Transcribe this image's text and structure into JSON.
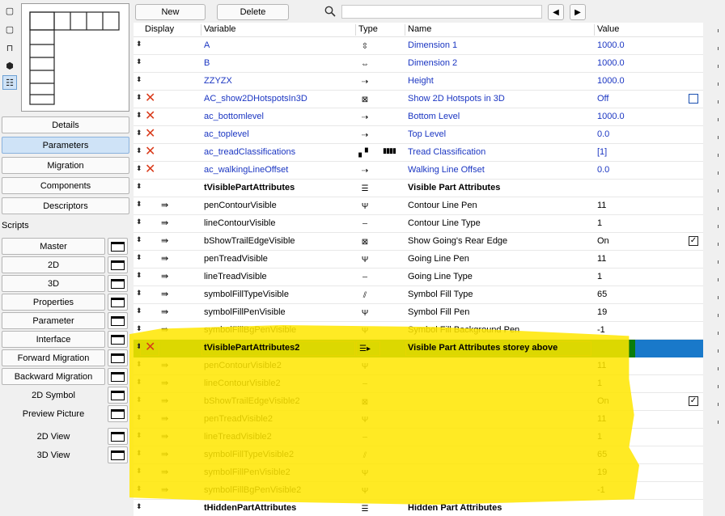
{
  "toolbar": {
    "new_label": "New",
    "delete_label": "Delete",
    "search_placeholder": "",
    "prev_label": "◀",
    "next_label": "▶"
  },
  "left_panel": {
    "sections": [
      "Details",
      "Parameters",
      "Migration",
      "Components",
      "Descriptors"
    ],
    "scripts_label": "Scripts",
    "scripts": [
      "Master",
      "2D",
      "3D",
      "Properties",
      "Parameter",
      "Interface",
      "Forward Migration",
      "Backward Migration"
    ],
    "plain_items": [
      "2D Symbol",
      "Preview Picture"
    ],
    "views": [
      "2D View",
      "3D View"
    ]
  },
  "table": {
    "headers": {
      "display": "Display",
      "variable": "Variable",
      "type": "Type",
      "name": "Name",
      "value": "Value"
    },
    "rows": [
      {
        "var": "A",
        "type_icon": "⇳",
        "name": "Dimension 1",
        "value": "1000.0",
        "style": "blue",
        "x": false,
        "disp": ""
      },
      {
        "var": "B",
        "type_icon": "⇔",
        "name": "Dimension 2",
        "value": "1000.0",
        "style": "blue",
        "x": false,
        "disp": ""
      },
      {
        "var": "ZZYZX",
        "type_icon": "⇢",
        "name": "Height",
        "value": "1000.0",
        "style": "blue",
        "x": false,
        "disp": ""
      },
      {
        "var": "AC_show2DHotspotsIn3D",
        "type_icon": "⊠",
        "name": "Show 2D Hotspots in 3D",
        "value": "Off",
        "style": "blue",
        "x": true,
        "disp": "",
        "check": "empty"
      },
      {
        "var": "ac_bottomlevel",
        "type_icon": "⇢",
        "name": "Bottom Level",
        "value": "1000.0",
        "style": "blue",
        "x": true,
        "disp": ""
      },
      {
        "var": "ac_toplevel",
        "type_icon": "⇢",
        "name": "Top Level",
        "value": "0.0",
        "style": "blue",
        "x": true,
        "disp": ""
      },
      {
        "var": "ac_treadClassifications",
        "type_icon": "▖▘",
        "type2": "▮▮▮▮",
        "name": "Tread Classification",
        "value": "[1]",
        "style": "blue",
        "x": true,
        "disp": ""
      },
      {
        "var": "ac_walkingLineOffset",
        "type_icon": "⇢",
        "name": "Walking Line Offset",
        "value": "0.0",
        "style": "blue",
        "x": true,
        "disp": ""
      },
      {
        "var": "tVisiblePartAttributes",
        "type_icon": "☰",
        "name": "Visible Part Attributes",
        "value": "",
        "style": "bold",
        "x": false,
        "disp": ""
      },
      {
        "var": "penContourVisible",
        "type_icon": "Ψ",
        "name": "Contour Line Pen",
        "value": "11",
        "style": "normal",
        "x": false,
        "disp": "⇛"
      },
      {
        "var": "lineContourVisible",
        "type_icon": "┄",
        "name": "Contour Line Type",
        "value": "1",
        "style": "normal",
        "x": false,
        "disp": "⇛"
      },
      {
        "var": "bShowTrailEdgeVisible",
        "type_icon": "⊠",
        "name": "Show Going's Rear Edge",
        "value": "On",
        "style": "normal",
        "x": false,
        "disp": "⇛",
        "check": "checked"
      },
      {
        "var": "penTreadVisible",
        "type_icon": "Ψ",
        "name": "Going Line Pen",
        "value": "11",
        "style": "normal",
        "x": false,
        "disp": "⇛"
      },
      {
        "var": "lineTreadVisible",
        "type_icon": "┄",
        "name": "Going Line Type",
        "value": "1",
        "style": "normal",
        "x": false,
        "disp": "⇛"
      },
      {
        "var": "symbolFillTypeVisible",
        "type_icon": "⫽",
        "name": "Symbol Fill Type",
        "value": "65",
        "style": "normal",
        "x": false,
        "disp": "⇛"
      },
      {
        "var": "symbolFillPenVisible",
        "type_icon": "Ψ",
        "name": "Symbol Fill Pen",
        "value": "19",
        "style": "normal",
        "x": false,
        "disp": "⇛"
      },
      {
        "var": "symbolFillBgPenVisible",
        "type_icon": "Ψ",
        "name": "Symbol Fill Background Pen",
        "value": "-1",
        "style": "normal",
        "x": false,
        "disp": "⇛"
      },
      {
        "var": "tVisiblePartAttributes2",
        "type_icon": "☰▸",
        "name": "Visible Part Attributes storey  above",
        "value": "",
        "style": "selected",
        "x": true,
        "disp": ""
      },
      {
        "var": "penContourVisible2",
        "type_icon": "Ψ",
        "name": "",
        "value": "11",
        "style": "normal",
        "x": false,
        "disp": "⇛"
      },
      {
        "var": "lineContourVisible2",
        "type_icon": "┄",
        "name": "",
        "value": "1",
        "style": "normal",
        "x": false,
        "disp": "⇛"
      },
      {
        "var": "bShowTrailEdgeVisible2",
        "type_icon": "⊠",
        "name": "",
        "value": "On",
        "style": "normal",
        "x": false,
        "disp": "⇛",
        "check": "checked"
      },
      {
        "var": "penTreadVisible2",
        "type_icon": "Ψ",
        "name": "",
        "value": "11",
        "style": "normal",
        "x": false,
        "disp": "⇛"
      },
      {
        "var": "lineTreadVisible2",
        "type_icon": "┄",
        "name": "",
        "value": "1",
        "style": "normal",
        "x": false,
        "disp": "⇛"
      },
      {
        "var": "symbolFillTypeVisible2",
        "type_icon": "⫽",
        "name": "",
        "value": "65",
        "style": "normal",
        "x": false,
        "disp": "⇛"
      },
      {
        "var": "symbolFillPenVisible2",
        "type_icon": "Ψ",
        "name": "",
        "value": "19",
        "style": "normal",
        "x": false,
        "disp": "⇛"
      },
      {
        "var": "symbolFillBgPenVisible2",
        "type_icon": "Ψ",
        "name": "",
        "value": "-1",
        "style": "normal",
        "x": false,
        "disp": "⇛"
      },
      {
        "var": "tHiddenPartAttributes",
        "type_icon": "☰",
        "name": "Hidden Part Attributes",
        "value": "",
        "style": "bold",
        "x": false,
        "disp": ""
      }
    ]
  },
  "colors": {
    "accent_blue": "#1b36c2",
    "selection": "#1979ca",
    "highlight": "#ffe600",
    "delete_x": "#d93a1a"
  }
}
